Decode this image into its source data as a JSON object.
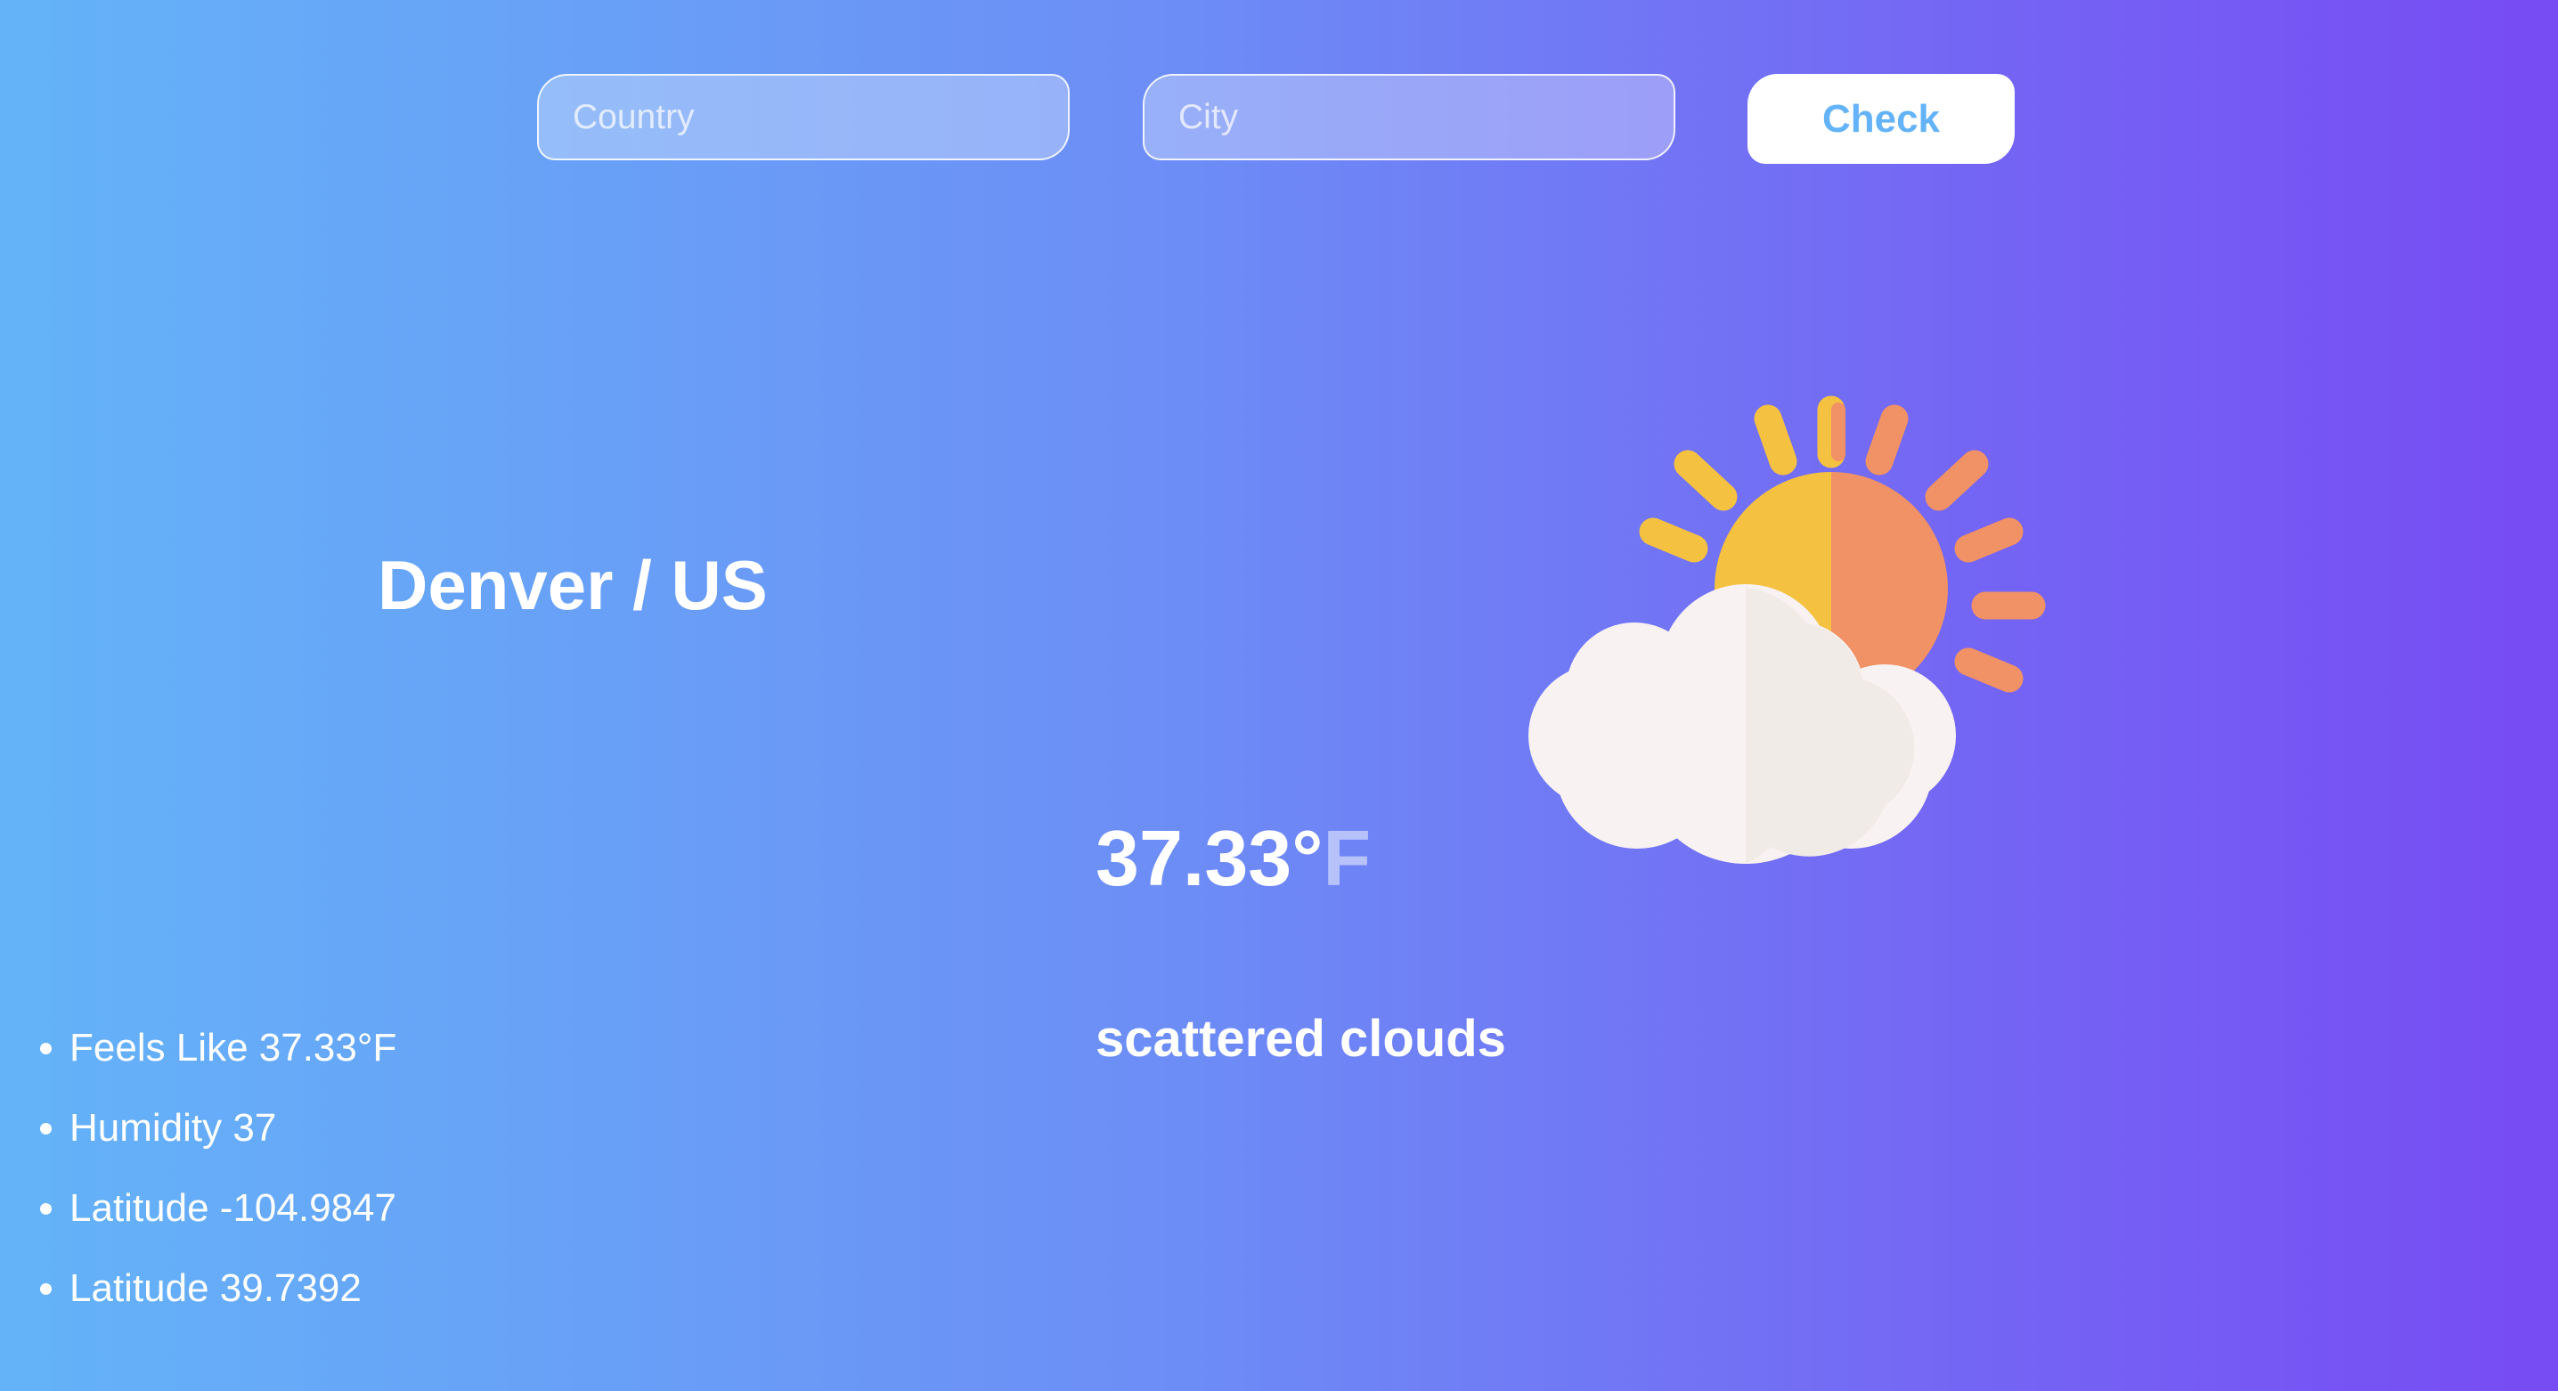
{
  "search": {
    "country_placeholder": "Country",
    "city_placeholder": "City",
    "check_label": "Check"
  },
  "weather": {
    "location": "Denver / US",
    "temperature": "37.33°",
    "unit": "F",
    "description": "scattered clouds",
    "icon": "partly-cloudy-sun-icon",
    "details": [
      "Feels Like 37.33°F",
      "Humidity 37",
      "Latitude -104.9847",
      "Latitude 39.7392"
    ]
  },
  "colors": {
    "gradient_start": "#64b3f8",
    "gradient_end": "#774bf3",
    "button_text": "#64b3f8",
    "sun_left": "#f4c141",
    "sun_right": "#f09166",
    "cloud": "#f9f2f2"
  }
}
